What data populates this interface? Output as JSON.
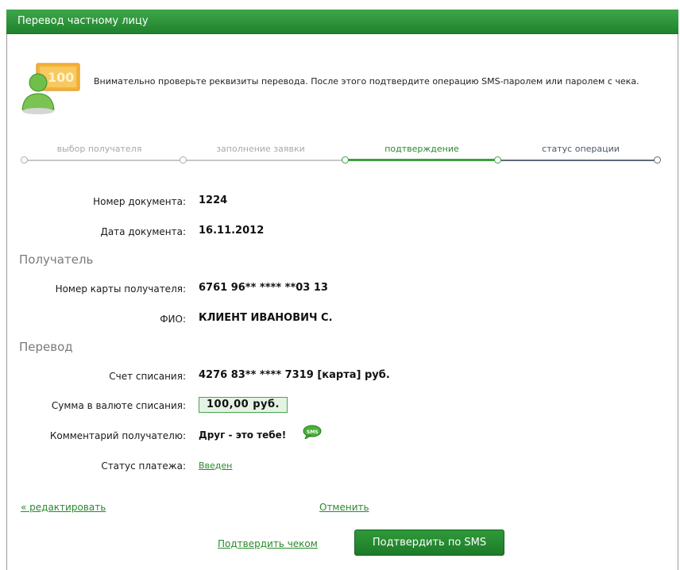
{
  "header": {
    "title": "Перевод частному лицу"
  },
  "intro": {
    "text": "Внимательно проверьте реквизиты перевода. После этого подтвердите операцию SMS-паролем или паролем с чека."
  },
  "steps": [
    {
      "label": "выбор получателя",
      "state": "done"
    },
    {
      "label": "заполнение заявки",
      "state": "done"
    },
    {
      "label": "подтверждение",
      "state": "current"
    },
    {
      "label": "статус операции",
      "state": "next"
    }
  ],
  "document": {
    "number_label": "Номер документа:",
    "number_value": "1224",
    "date_label": "Дата документа:",
    "date_value": "16.11.2012"
  },
  "recipient": {
    "section_title": "Получатель",
    "card_label": "Номер карты получателя:",
    "card_value": "6761 96** **** **03 13",
    "name_label": "ФИО:",
    "name_value": "КЛИЕНТ ИВАНОВИЧ С."
  },
  "transfer": {
    "section_title": "Перевод",
    "account_label": "Счет списания:",
    "account_value": "4276 83** **** 7319  [карта]  руб.",
    "amount_label": "Сумма в валюте списания:",
    "amount_value": "100,00  руб.",
    "comment_label": "Комментарий получателю:",
    "comment_value": "Друг - это тебе!",
    "status_label": "Статус платежа:",
    "status_value": "Введен"
  },
  "actions": {
    "edit_link": "« редактировать",
    "cancel_link": "Отменить",
    "confirm_check_link": "Подтвердить чеком",
    "confirm_sms_button": "Подтвердить по SMS"
  },
  "colors": {
    "brand_green": "#2a8a2a",
    "header_green": "#20822d",
    "step_done": "#a9a9a9",
    "step_current": "#2a8a2a",
    "step_next": "#4a5a6a"
  },
  "icons": {
    "hero": "user-with-banknote-icon",
    "sms": "sms-bubble-icon"
  }
}
